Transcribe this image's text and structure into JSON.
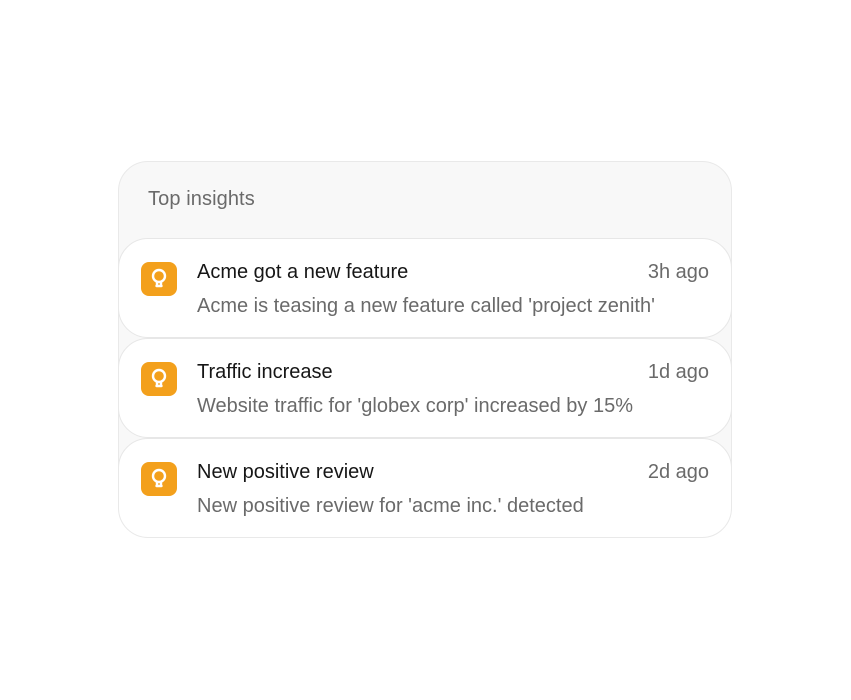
{
  "panel": {
    "title": "Top insights",
    "accent_color": "#f3a01c",
    "items": [
      {
        "icon": "lightbulb-icon",
        "title": "Acme got a new feature",
        "time": "3h ago",
        "description": "Acme is teasing a new feature called 'project zenith'"
      },
      {
        "icon": "lightbulb-icon",
        "title": "Traffic increase",
        "time": "1d ago",
        "description": "Website traffic for 'globex corp' increased by 15%"
      },
      {
        "icon": "lightbulb-icon",
        "title": "New positive review",
        "time": "2d ago",
        "description": "New positive review for 'acme inc.' detected"
      }
    ]
  }
}
